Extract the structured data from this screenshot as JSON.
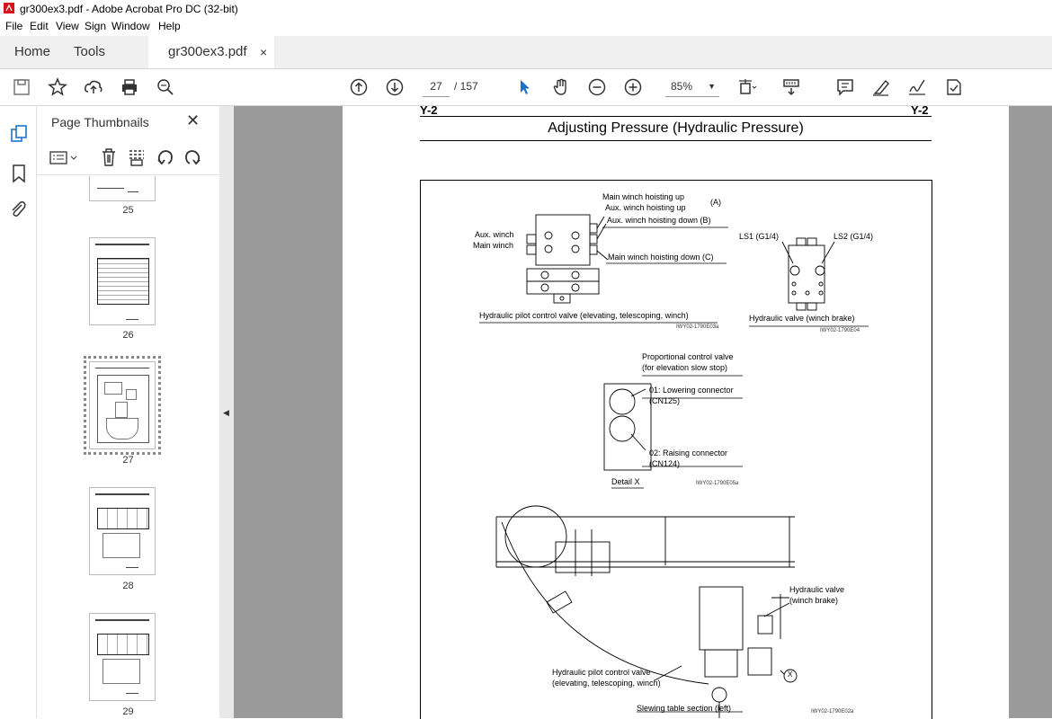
{
  "window": {
    "title": "gr300ex3.pdf - Adobe Acrobat Pro DC (32-bit)"
  },
  "menu": [
    "File",
    "Edit",
    "View",
    "Sign",
    "Window",
    "Help"
  ],
  "tabs": {
    "home": "Home",
    "tools": "Tools",
    "document": "gr300ex3.pdf",
    "close": "×"
  },
  "toolbar": {
    "page_current": "27",
    "page_total": "/ 157",
    "zoom": "85%"
  },
  "panel": {
    "title": "Page Thumbnails",
    "thumbs": [
      {
        "label": "25"
      },
      {
        "label": "26"
      },
      {
        "label": "27",
        "selected": true
      },
      {
        "label": "28"
      },
      {
        "label": "29"
      }
    ]
  },
  "doc": {
    "running_left": "Y-2",
    "running_right": "Y-2",
    "title": "Adjusting Pressure (Hydraulic Pressure)",
    "labels": {
      "main_winch_up": "Main winch hoisting up",
      "a": "(A)",
      "aux_winch_up": "Aux. winch hoisting up",
      "aux_winch_down": "Aux. winch hoisting down (B)",
      "aux_winch": "Aux. winch",
      "main_winch": "Main winch",
      "main_winch_down": "Main winch hoisting down (C)",
      "pilot_valve": "Hydraulic pilot control valve (elevating, telescoping, winch)",
      "code1": "IWY02-1790E03a",
      "ls1": "LS1 (G1/4)",
      "ls2": "LS2 (G1/4)",
      "hyd_valve": "Hydraulic valve (winch brake)",
      "code2": "IWY02-1790E04",
      "prop_valve": "Proportional control valve",
      "prop_valve2": "(for elevation slow stop)",
      "lowering": "01: Lowering connector",
      "cn125": "(CN125)",
      "raising": "02: Raising connector",
      "cn124": "(CN124)",
      "detail_x": "Detail X",
      "code3": "IWY02-1790E05a",
      "hv2a": "Hydraulic valve",
      "hv2b": "(winch brake)",
      "pcv_a": "Hydraulic pilot control valve",
      "pcv_b": "(elevating, telescoping, winch)",
      "x_mark": "X",
      "slewing": "Slewing table section (left)",
      "code4": "IWY02-1790E02a"
    }
  }
}
